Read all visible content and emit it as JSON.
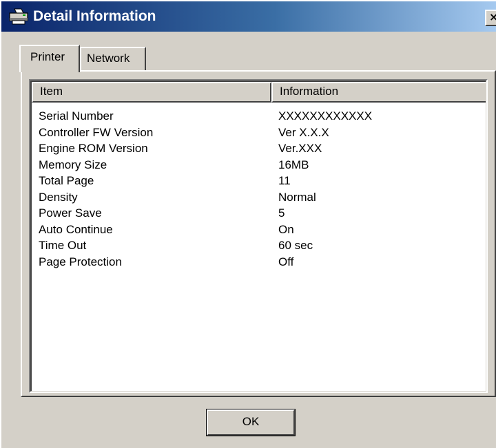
{
  "window": {
    "title": "Detail Information",
    "title_icon": "printer-icon",
    "close_label": "×",
    "title_gradient_start": "#0a246a",
    "title_gradient_end": "#a6caf0",
    "face_color": "#d4d0c8"
  },
  "tabs": [
    {
      "label": "Printer",
      "selected": true
    },
    {
      "label": "Network",
      "selected": false
    }
  ],
  "list": {
    "columns": [
      "Item",
      "Information"
    ],
    "rows": [
      {
        "item": "Serial Number",
        "info": "XXXXXXXXXXXX"
      },
      {
        "item": "Controller FW Version",
        "info": "Ver X.X.X"
      },
      {
        "item": "Engine ROM Version",
        "info": "Ver.XXX"
      },
      {
        "item": "Memory Size",
        "info": "16MB"
      },
      {
        "item": "Total Page",
        "info": "11"
      },
      {
        "item": "Density",
        "info": "Normal"
      },
      {
        "item": "Power Save",
        "info": "5"
      },
      {
        "item": "Auto Continue",
        "info": "On"
      },
      {
        "item": "Time Out",
        "info": "60 sec"
      },
      {
        "item": "Page Protection",
        "info": "Off"
      }
    ]
  },
  "buttons": {
    "ok_label": "OK"
  }
}
